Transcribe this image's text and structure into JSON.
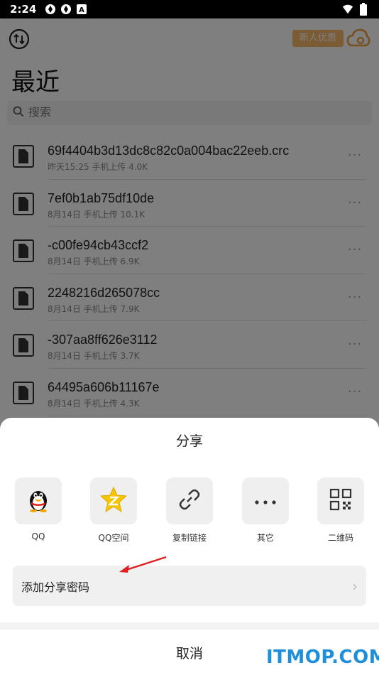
{
  "status_bar": {
    "time": "2:24",
    "left_icons": [
      "notification-icon",
      "notification-icon",
      "a-badge-icon"
    ],
    "right_icons": [
      "wifi-icon",
      "battery-icon"
    ]
  },
  "header": {
    "promo_badge": "新人优惠",
    "title": "最近",
    "search_placeholder": "搜索"
  },
  "files": [
    {
      "name": "69f4404b3d13dc8c82c0a004bac22eeb.crc",
      "meta": "昨天15:25  手机上传  4.0K"
    },
    {
      "name": "7ef0b1ab75df10de",
      "meta": "8月14日  手机上传  10.1K"
    },
    {
      "name": "-c00fe94cb43ccf2",
      "meta": "8月14日  手机上传  6.9K"
    },
    {
      "name": "2248216d265078cc",
      "meta": "8月14日  手机上传  7.9K"
    },
    {
      "name": "-307aa8ff626e3112",
      "meta": "8月14日  手机上传  3.7K"
    },
    {
      "name": "64495a606b11167e",
      "meta": "8月14日  手机上传  4.3K"
    }
  ],
  "more_glyph": "···",
  "share_sheet": {
    "title": "分享",
    "options": [
      {
        "label": "QQ",
        "icon": "qq-penguin-icon"
      },
      {
        "label": "QQ空间",
        "icon": "qzone-star-icon"
      },
      {
        "label": "复制链接",
        "icon": "link-icon"
      },
      {
        "label": "其它",
        "icon": "more-icon"
      },
      {
        "label": "二维码",
        "icon": "qrcode-icon"
      }
    ],
    "add_password_label": "添加分享密码",
    "chevron": "›",
    "cancel_label": "取消"
  },
  "watermark": "ITMOP.COM",
  "colors": {
    "promo": "#f6b86b",
    "qzone_star": "#f7c600",
    "annotation_arrow": "#e02020",
    "watermark": "#1e8fd8"
  }
}
